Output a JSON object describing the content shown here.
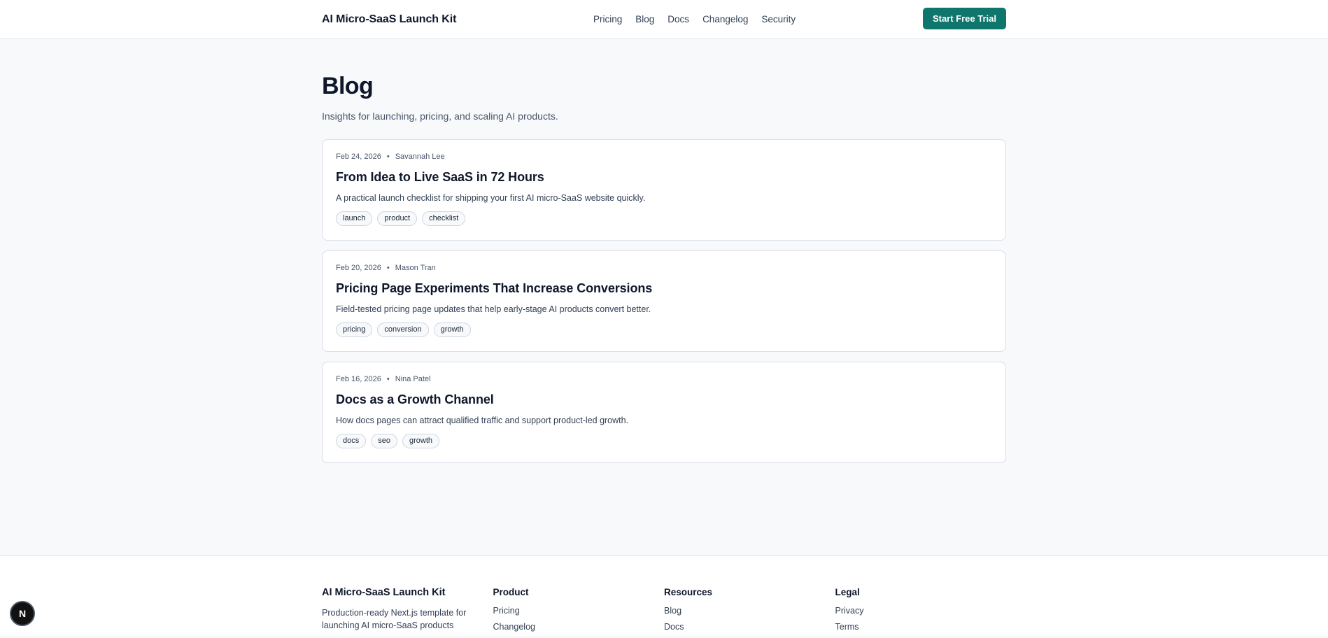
{
  "header": {
    "brand": "AI Micro-SaaS Launch Kit",
    "nav": [
      "Pricing",
      "Blog",
      "Docs",
      "Changelog",
      "Security"
    ],
    "cta": "Start Free Trial"
  },
  "main": {
    "title": "Blog",
    "subtitle": "Insights for launching, pricing, and scaling AI products.",
    "posts": [
      {
        "date": "Feb 24, 2026",
        "author": "Savannah Lee",
        "title": "From Idea to Live SaaS in 72 Hours",
        "excerpt": "A practical launch checklist for shipping your first AI micro-SaaS website quickly.",
        "tags": [
          "launch",
          "product",
          "checklist"
        ]
      },
      {
        "date": "Feb 20, 2026",
        "author": "Mason Tran",
        "title": "Pricing Page Experiments That Increase Conversions",
        "excerpt": "Field-tested pricing page updates that help early-stage AI products convert better.",
        "tags": [
          "pricing",
          "conversion",
          "growth"
        ]
      },
      {
        "date": "Feb 16, 2026",
        "author": "Nina Patel",
        "title": "Docs as a Growth Channel",
        "excerpt": "How docs pages can attract qualified traffic and support product-led growth.",
        "tags": [
          "docs",
          "seo",
          "growth"
        ]
      }
    ]
  },
  "footer": {
    "brand": "AI Micro-SaaS Launch Kit",
    "description": "Production-ready Next.js template for launching AI micro-SaaS products",
    "columns": [
      {
        "heading": "Product",
        "links": [
          "Pricing",
          "Changelog"
        ]
      },
      {
        "heading": "Resources",
        "links": [
          "Blog",
          "Docs"
        ]
      },
      {
        "heading": "Legal",
        "links": [
          "Privacy",
          "Terms"
        ]
      }
    ]
  },
  "dev_badge": {
    "icon": "nextjs-logo-icon",
    "letter": "N"
  },
  "colors": {
    "accent": "#0f766e",
    "background": "#f8f9fb"
  },
  "separator": "•"
}
